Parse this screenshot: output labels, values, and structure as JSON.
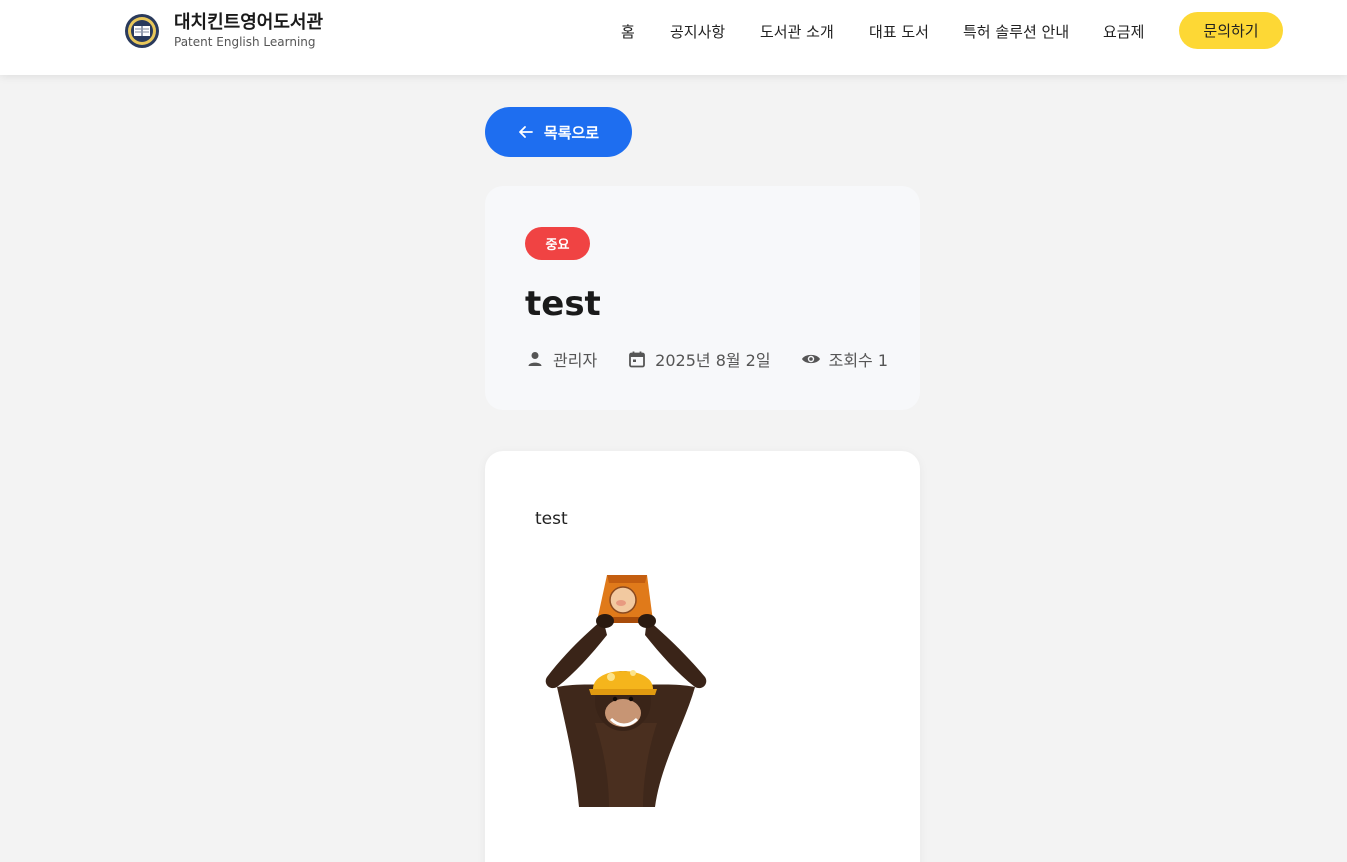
{
  "header": {
    "logo_title": "대치킨트영어도서관",
    "logo_subtitle": "Patent English Learning",
    "nav": [
      "홈",
      "공지사항",
      "도서관 소개",
      "대표 도서",
      "특허 솔루션 안내",
      "요금제"
    ],
    "cta_label": "문의하기"
  },
  "post": {
    "back_label": "목록으로",
    "badge": "중요",
    "title": "test",
    "author": "관리자",
    "date": "2025년 8월 2일",
    "views": "조회수  1",
    "body_text": "test"
  },
  "colors": {
    "accent_blue": "#1e6ef0",
    "badge_red": "#f04343",
    "cta_yellow": "#fdd835"
  },
  "icons": [
    "arrow-left-icon",
    "person-icon",
    "calendar-icon",
    "eye-icon"
  ]
}
